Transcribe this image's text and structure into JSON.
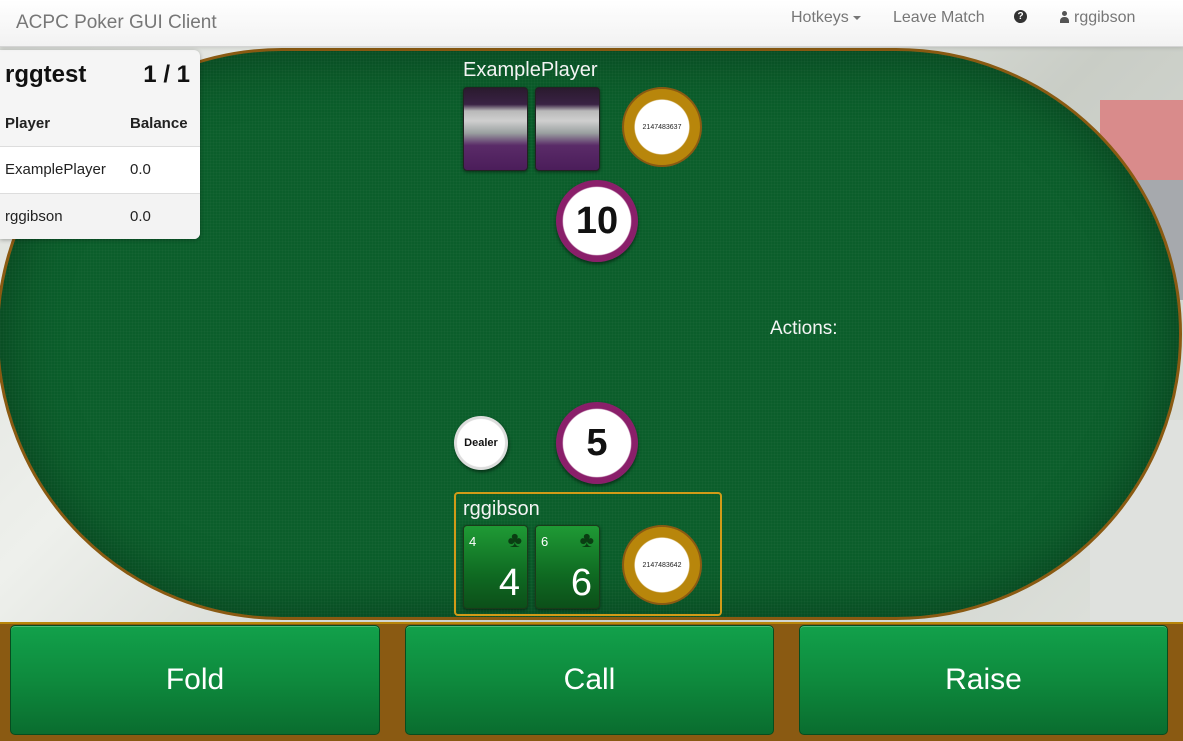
{
  "navbar": {
    "brand": "ACPC Poker GUI Client",
    "hotkeys_label": "Hotkeys",
    "leave_match_label": "Leave Match",
    "help_glyph": "?",
    "username": "rggibson"
  },
  "scoreboard": {
    "match_name": "rggtest",
    "hand_count": "1 / 1",
    "columns": [
      "Player",
      "Balance"
    ],
    "rows": [
      {
        "player": "ExamplePlayer",
        "balance": "0.0"
      },
      {
        "player": "rggibson",
        "balance": "0.0"
      }
    ]
  },
  "opponent": {
    "name": "ExamplePlayer",
    "stack": "2147483637",
    "bet": "10"
  },
  "hero": {
    "name": "rggibson",
    "stack": "2147483642",
    "bet": "5",
    "cards": [
      {
        "corner": "4",
        "rank": "4",
        "suit": "♣"
      },
      {
        "corner": "6",
        "rank": "6",
        "suit": "♣"
      }
    ]
  },
  "dealer_label": "Dealer",
  "actions_label": "Actions:",
  "buttons": {
    "fold": "Fold",
    "call": "Call",
    "raise": "Raise"
  },
  "icons": {
    "hotkeys_dropdown": "caret-down-icon",
    "help": "question-circle-icon",
    "user": "user-icon"
  },
  "colors": {
    "felt": "#0b5e2b",
    "rail": "#8a5a12",
    "button": "#0e8a3d",
    "bet_chip": "#8a1f6a",
    "highlight": "#d29b18"
  }
}
